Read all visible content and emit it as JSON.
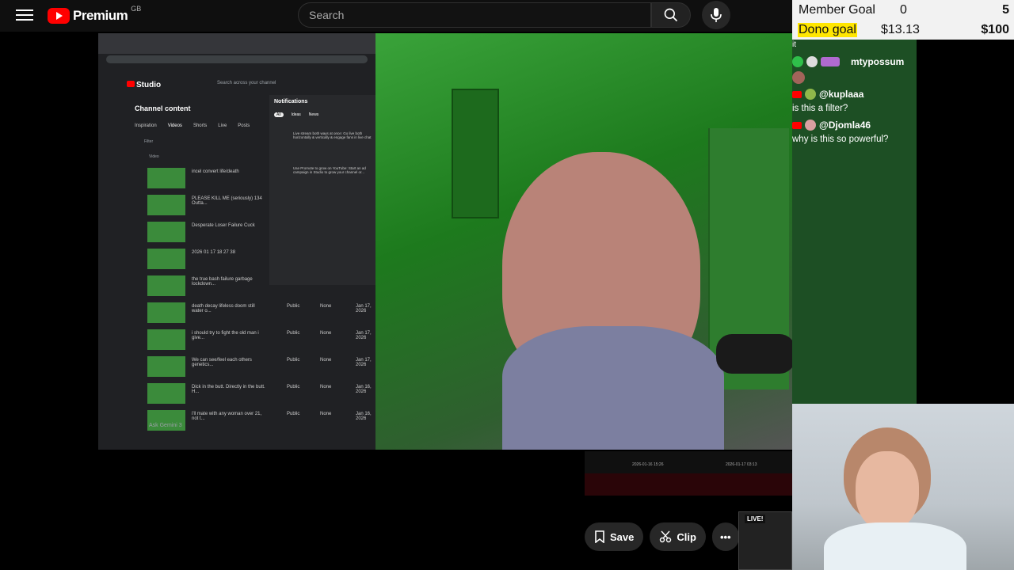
{
  "header": {
    "logo_text": "Premium",
    "region": "GB",
    "search_placeholder": "Search"
  },
  "goals": {
    "member_label": "Member Goal",
    "member_current": "0",
    "member_target": "5",
    "dono_label": "Dono goal",
    "dono_current": "$13.13",
    "dono_target": "$100"
  },
  "chat": {
    "fragment": "it",
    "messages": [
      {
        "user": "mtypossum",
        "text": ""
      },
      {
        "user": "@kuplaaa",
        "text": "is this a filter?"
      },
      {
        "user": "@Djomla46",
        "text": "why is this so powerful?"
      }
    ]
  },
  "studio": {
    "title": "Studio",
    "search": "Search across your channel",
    "page_title": "Channel content",
    "tabs": [
      "Inspiration",
      "Videos",
      "Shorts",
      "Live",
      "Posts"
    ],
    "notifications_title": "Notifications",
    "notif_filters": [
      "All",
      "Ideas",
      "News"
    ],
    "notif_items": [
      "Live stream both ways at once: Go live both horizontally & vertically & engage fans in live chat",
      "Use Promote to grow on YouTube: Start an ad campaign in Studio to grow your channel or..."
    ],
    "filter_label": "Filter",
    "col_title": "Video",
    "videos": [
      {
        "title": "incel convert life/death",
        "vis": "",
        "rest": "",
        "date": ""
      },
      {
        "title": "PLEASE KILL ME (seriously) 134 Outta...",
        "vis": "",
        "rest": "",
        "date": ""
      },
      {
        "title": "Desperate Loser Failure Cuck",
        "vis": "",
        "rest": "",
        "date": ""
      },
      {
        "title": "2026 01 17 18 27 38",
        "vis": "",
        "rest": "",
        "date": ""
      },
      {
        "title": "the true bash failure garbage lockdown...",
        "vis": "",
        "rest": "",
        "date": ""
      },
      {
        "title": "death decay lifeless doom still water o...",
        "vis": "Public",
        "rest": "None",
        "date": "Jan 17, 2026"
      },
      {
        "title": "i should try to fight the old man i give...",
        "vis": "Public",
        "rest": "None",
        "date": "Jan 17, 2026"
      },
      {
        "title": "We can see/feel each others genetics...",
        "vis": "Public",
        "rest": "None",
        "date": "Jan 17, 2026"
      },
      {
        "title": "Dick in the butt. Directly in the butt. H...",
        "vis": "Public",
        "rest": "None",
        "date": "Jan 16, 2026"
      },
      {
        "title": "i'll mate with any woman over 21, not t...",
        "vis": "Public",
        "rest": "None",
        "date": "Jan 16, 2026"
      }
    ],
    "ask": "Ask Gemini 3"
  },
  "actions": {
    "save": "Save",
    "clip": "Clip",
    "more": "•••"
  },
  "timeline": {
    "left_date": "2026-01-16 15:26",
    "right_date": "2026-01-17 03:13"
  },
  "live_badge": "LIVE!",
  "colors": {
    "youtube_red": "#ff0000",
    "goal_highlight": "#ffe600"
  }
}
